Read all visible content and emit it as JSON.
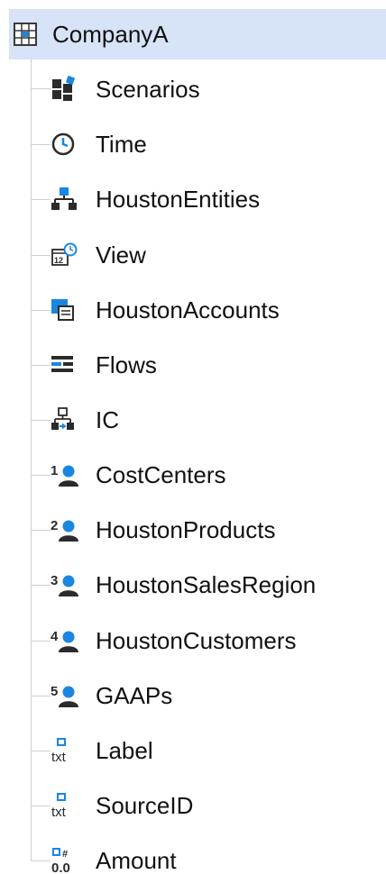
{
  "tree": {
    "root": {
      "label": "CompanyA",
      "icon": "cube-grid-icon"
    },
    "items": [
      {
        "label": "Scenarios",
        "icon": "scenarios-icon"
      },
      {
        "label": "Time",
        "icon": "clock-icon"
      },
      {
        "label": "HoustonEntities",
        "icon": "entity-hierarchy-icon"
      },
      {
        "label": "View",
        "icon": "calendar-view-icon"
      },
      {
        "label": "HoustonAccounts",
        "icon": "accounts-icon"
      },
      {
        "label": "Flows",
        "icon": "flows-icon"
      },
      {
        "label": "IC",
        "icon": "intercompany-icon"
      },
      {
        "label": "CostCenters",
        "icon": "custom-dimension-icon",
        "badge": "1"
      },
      {
        "label": "HoustonProducts",
        "icon": "custom-dimension-icon",
        "badge": "2"
      },
      {
        "label": "HoustonSalesRegion",
        "icon": "custom-dimension-icon",
        "badge": "3"
      },
      {
        "label": "HoustonCustomers",
        "icon": "custom-dimension-icon",
        "badge": "4"
      },
      {
        "label": "GAAPs",
        "icon": "custom-dimension-icon",
        "badge": "5"
      },
      {
        "label": "Label",
        "icon": "text-attribute-icon",
        "icon_text": "txt"
      },
      {
        "label": "SourceID",
        "icon": "text-attribute-icon",
        "icon_text": "txt"
      },
      {
        "label": "Amount",
        "icon": "numeric-attribute-icon",
        "icon_text": "0.0"
      }
    ]
  },
  "colors": {
    "selected_background": "#d7e3f6",
    "icon_blue": "#1a86e0",
    "icon_dark": "#2b2b2b",
    "tree_line": "#cfcfcf"
  }
}
